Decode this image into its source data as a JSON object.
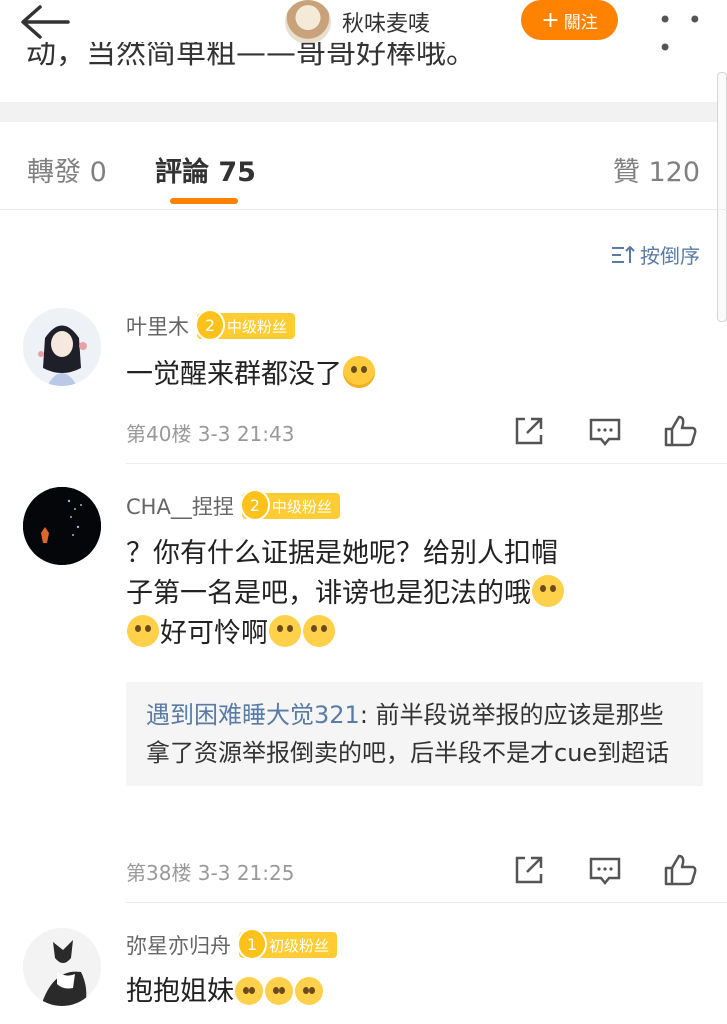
{
  "header": {
    "title": "秋味麦唛",
    "follow_label": "關注",
    "more_label": "• • •"
  },
  "post": {
    "truncated_text": "动，当然简单粗——哥哥好棒哦。"
  },
  "tabs": {
    "repost": "轉發 0",
    "comment": "評論 75",
    "like": "贊 120"
  },
  "sort_label": "按倒序",
  "comments": [
    {
      "author": "叶里木",
      "badge_level": "2",
      "badge_label": "中级粉丝",
      "text": "一觉醒来群都没了",
      "meta": "第40楼 3-3 21:43"
    },
    {
      "author": "CHA__捏捏",
      "badge_level": "2",
      "badge_label": "中级粉丝",
      "text_line1": "？你有什么证据是她呢？给别人扣帽",
      "text_line2": "子第一名是吧，诽谤也是犯法的哦",
      "text_line3": "好可怜啊",
      "reply_author": "遇到困难睡大觉321",
      "reply_text": "前半段说举报的应该是那些拿了资源举报倒卖的吧，后半段不是才cue到超话",
      "meta": "第38楼 3-3 21:25"
    },
    {
      "author": "弥星亦归舟",
      "badge_level": "1",
      "badge_label": "初级粉丝",
      "text": "抱抱姐妹"
    }
  ],
  "colors": {
    "accent": "#ff8200",
    "link": "#5a7ba6",
    "badge": "#ffcc33"
  }
}
